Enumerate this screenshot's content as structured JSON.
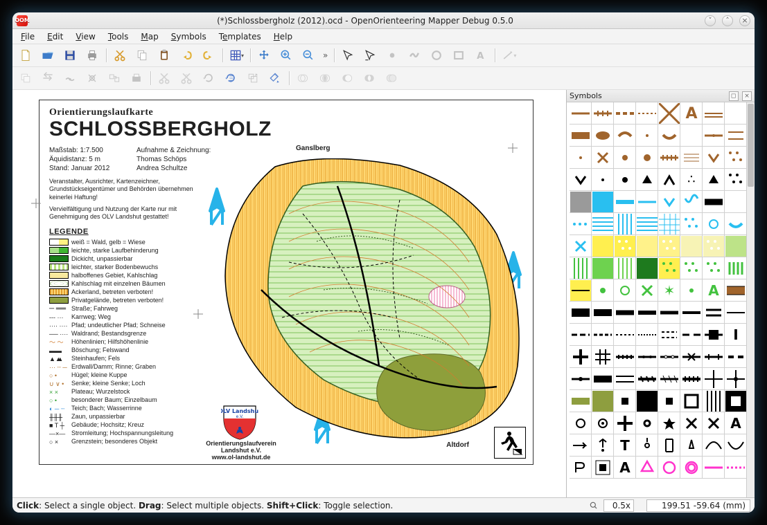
{
  "window": {
    "app_icon_label": "OOM",
    "title": "(*)Schlossbergholz (2012).ocd - OpenOrienteering Mapper Debug 0.5.0"
  },
  "menus": [
    "File",
    "Edit",
    "View",
    "Tools",
    "Map",
    "Symbols",
    "Templates",
    "Help"
  ],
  "panels": {
    "symbols_title": "Symbols"
  },
  "statusbar": {
    "hint_click_label": "Click",
    "hint_click": ": Select a single object. ",
    "hint_drag_label": "Drag",
    "hint_drag": ": Select multiple objects. ",
    "hint_shift_label": "Shift+Click",
    "hint_shift": ": Toggle selection.",
    "zoom": "0.5x",
    "coords": "199.51 -59.64 (mm)"
  },
  "map": {
    "pretitle": "Orientierungslaufkarte",
    "title": "SCHLOSSBERGHOLZ",
    "scale_label": "Maßstab: 1:7.500",
    "equi_label": "Äquidistanz: 5 m",
    "date_label": "Stand: Januar 2012",
    "credit_head": "Aufnahme & Zeichnung:",
    "credit_1": "Thomas Schöps",
    "credit_2": "Andrea Schultze",
    "disclaimer_1": "Veranstalter, Ausrichter, Kartenzeichner, Grundstückseigentümer und Behörden übernehmen keinerlei Haftung!",
    "disclaimer_2": "Vervielfältigung und Nutzung der Karte nur mit Genehmigung des OLV Landshut gestattet!",
    "legend_title": "LEGENDE",
    "shield_line1": "OLV Landshut",
    "shield_line2": "e.V.",
    "caption_line1": "Orientierungslaufverein",
    "caption_line2": "Landshut e.V.",
    "caption_url": "www.ol-landshut.de",
    "place_1": "Ganslberg",
    "place_2": "Altdorf",
    "legend": [
      "weiß = Wald, gelb = Wiese",
      "leichte, starke Laufbehinderung",
      "Dickicht, unpassierbar",
      "leichter, starker Bodenbewuchs",
      "halboffenes Gebiet, Kahlschlag",
      "Kahlschlag mit einzelnen Bäumen",
      "Ackerland, betreten verboten!",
      "Privatgelände, betreten verboten!",
      "Straße;  Fahrweg",
      "Karrweg; Weg",
      "Pfad; undeutlicher Pfad; Schneise",
      "Waldrand; Bestandsgrenze",
      "Höhenlinien; Hilfshöhenlinie",
      "Böschung; Felswand",
      "Steinhaufen; Fels",
      "Erdwall/Damm; Rinne; Graben",
      "Hügel; kleine Kuppe",
      "Senke; kleine Senke; Loch",
      "Plateau; Wurzelstock",
      "besonderer Baum; Einzelbaum",
      "Teich; Bach; Wasserrinne",
      "Zaun, unpassierbar",
      "Gebäude; Hochsitz; Kreuz",
      "Stromleitung; Hochspannungsleitung",
      "Grenzstein; besonderes Objekt"
    ],
    "legend_prefix": {
      "8": "─  ══",
      "9": "---  ···",
      "10": "····  ····",
      "11": "──  ····",
      "13": "▬▬  ▲▲",
      "14": "▲  ▲",
      "15": "···  ┄  ─",
      "16": "○  •",
      "17": "∪  ∨  •",
      "18": "×  ×",
      "19": "○  •",
      "20": "◐  ─  ┄",
      "21": "╫╫╫",
      "22": "■ T ┼",
      "23": "—×—",
      "24": "○  ×"
    }
  }
}
